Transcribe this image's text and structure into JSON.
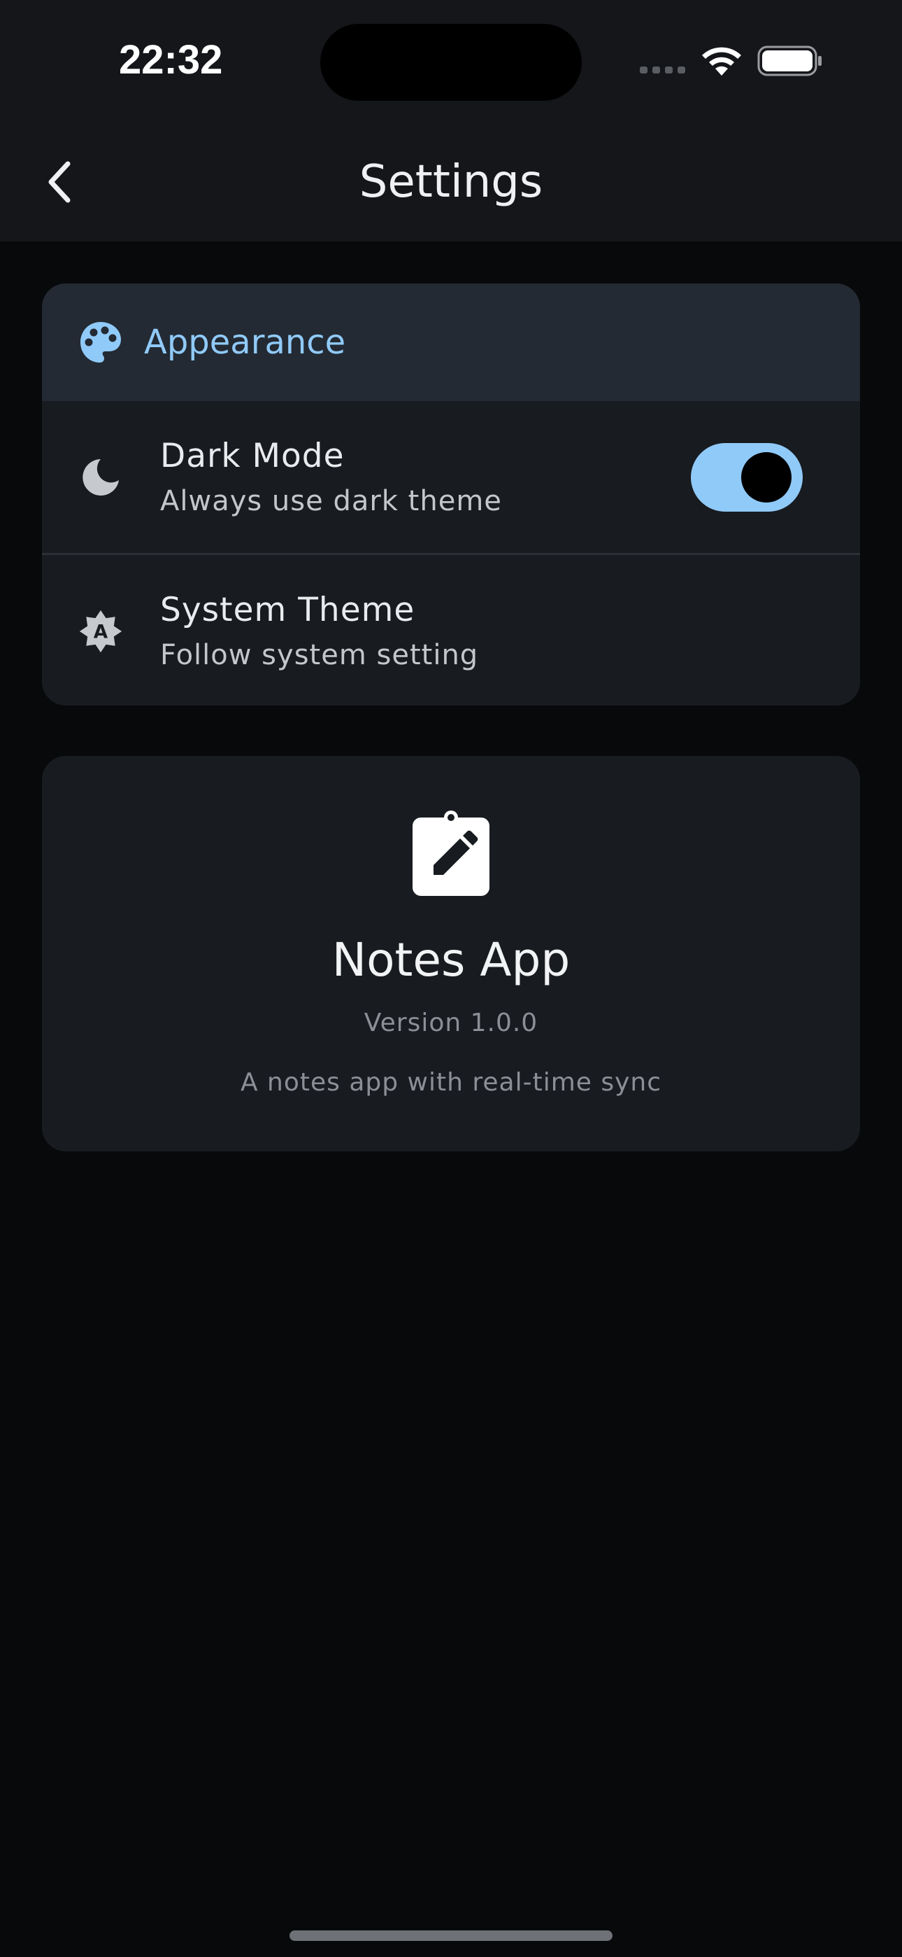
{
  "status_bar": {
    "time": "22:32"
  },
  "header": {
    "title": "Settings",
    "back_icon": "chevron-left-icon"
  },
  "appearance_section": {
    "title": "Appearance",
    "icon": "palette-icon",
    "accent_color": "#90caf9",
    "rows": [
      {
        "title": "Dark Mode",
        "subtitle": "Always use dark theme",
        "icon": "moon-icon",
        "toggle_on": true
      },
      {
        "title": "System Theme",
        "subtitle": "Follow system setting",
        "icon": "brightness-auto-icon"
      }
    ]
  },
  "about": {
    "app_icon": "clipboard-edit-icon",
    "app_name": "Notes App",
    "version": "Version 1.0.0",
    "description": "A notes app with real-time sync"
  }
}
